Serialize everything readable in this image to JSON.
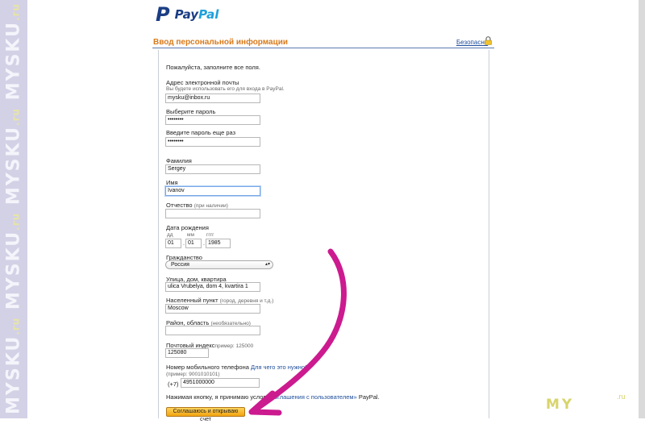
{
  "watermark": {
    "text": "MYSKU",
    "suffix": ".ru"
  },
  "logo": {
    "pay": "Pay",
    "pal": "Pal"
  },
  "header": {
    "title": "Ввод персональной информации",
    "secure_link": "Безопасно"
  },
  "form": {
    "intro": "Пожалуйста, заполните все поля.",
    "email": {
      "label": "Адрес электронной почты",
      "hint": "Вы будете использовать его для входа в PayPal.",
      "value": "mysku@inbox.ru"
    },
    "password": {
      "label": "Выберите пароль",
      "value": "••••••••"
    },
    "password_repeat": {
      "label": "Введите пароль еще раз",
      "value": "••••••••"
    },
    "last_name": {
      "label": "Фамилия",
      "value": "Sergey"
    },
    "first_name": {
      "label": "Имя",
      "value": "Ivanov"
    },
    "middle_name": {
      "label": "Отчество",
      "hint": "(при наличии)",
      "value": ""
    },
    "birth_date": {
      "label": "Дата рождения",
      "dd_label": "дд",
      "mm_label": "мм",
      "yyyy_label": "гггг",
      "dd": "01",
      "mm": "01",
      "yyyy": "1985",
      "separator": "."
    },
    "citizenship": {
      "label": "Гражданство",
      "value": "Россия"
    },
    "street": {
      "label": "Улица, дом, квартира",
      "value": "ulica Vrubelya, dom 4, kvartira 1"
    },
    "city": {
      "label": "Населенный пункт",
      "hint": "(город, деревня и т.д.)",
      "value": "Moscow"
    },
    "region": {
      "label": "Район, область",
      "hint": "(необязательно)",
      "value": ""
    },
    "postal": {
      "label": "Почтовый индекс",
      "hint": "пример: 125000",
      "value": "125080"
    },
    "mobile": {
      "label": "Номер мобильного телефона",
      "why_link": "Для чего это нужно?",
      "hint": "(пример: 9001010101)",
      "prefix": "(+7)",
      "value": "4951000000"
    },
    "agreement": {
      "before": "Нажимая кнопку, я принимаю услов",
      "link": "«Соглашения с пользователем»",
      "after": " PayPal."
    },
    "submit_label": "Соглашаюсь и открываю счет"
  },
  "corner_brand": {
    "my": "MY",
    "ru": ".ru"
  }
}
